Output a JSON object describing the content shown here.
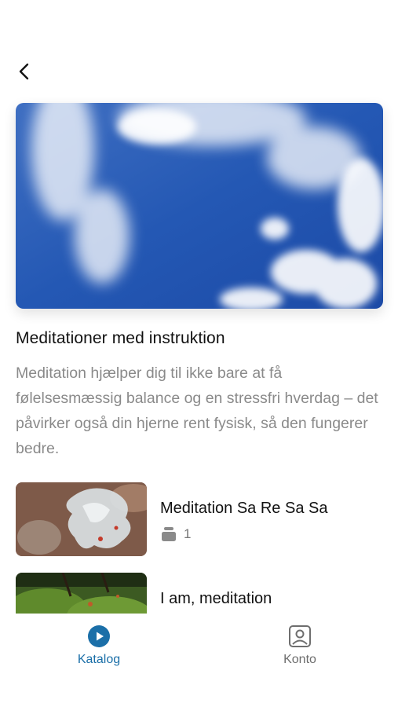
{
  "header": {
    "back_icon": "chevron-left-icon"
  },
  "collection": {
    "title": "Meditationer med instruktion",
    "description": "Meditation hjælper dig til ikke bare at få følelsesmæssig balance og en stressfri hverdag – det påvirker også din hjerne rent fysisk, så den fungerer bedre."
  },
  "items": [
    {
      "title": "Meditation Sa Re Sa Sa",
      "count": "1",
      "count_icon": "stack-icon"
    },
    {
      "title": "I am, meditation"
    }
  ],
  "tabbar": {
    "tabs": [
      {
        "label": "Katalog",
        "icon": "play-circle-icon",
        "active": true
      },
      {
        "label": "Konto",
        "icon": "account-icon",
        "active": false
      }
    ]
  },
  "colors": {
    "accent": "#1b6fa8",
    "muted_text": "#8a8a8a"
  }
}
